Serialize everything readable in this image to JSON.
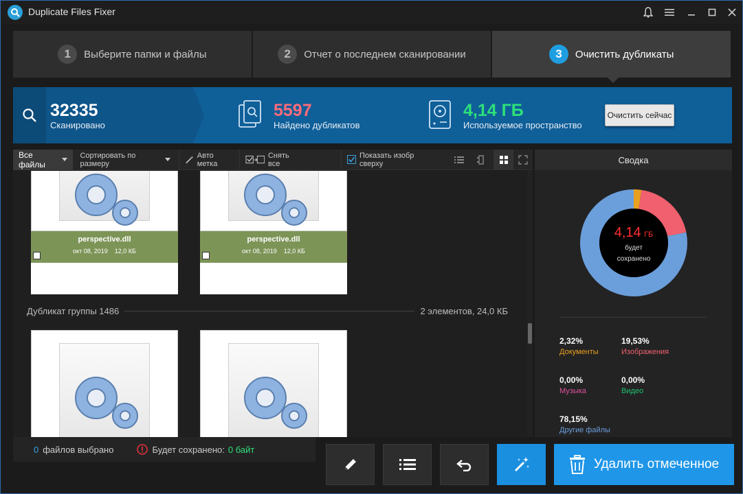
{
  "app": {
    "title": "Duplicate Files Fixer"
  },
  "steps": [
    {
      "num": "1",
      "label": "Выберите папки и файлы"
    },
    {
      "num": "2",
      "label": "Отчет о последнем сканировании"
    },
    {
      "num": "3",
      "label": "Очистить дубликаты"
    }
  ],
  "stats": {
    "scanned_value": "32335",
    "scanned_label": "Сканировано",
    "dupes_value": "5597",
    "dupes_label": "Найдено дубликатов",
    "space_value": "4,14 ГБ",
    "space_label": "Используемое пространство",
    "clean_now": "Очистить сейчас",
    "colors": {
      "dupes": "#ff6b7a",
      "space": "#2ee07a"
    }
  },
  "toolbar": {
    "all_files": "Все файлы",
    "sort": "Сортировать по размеру",
    "auto_mark": "Авто метка",
    "unselect_all": "Снять все",
    "show_preview": "Показать изобр сверху"
  },
  "files": [
    {
      "name": "perspective.dll",
      "date": "окт 08, 2019",
      "size": "12,0 КБ"
    },
    {
      "name": "perspective.dll",
      "date": "окт 08, 2019",
      "size": "12,0 КБ"
    }
  ],
  "group": {
    "title": "Дубликат группы 1486",
    "info": "2 элементов, 24,0 КБ"
  },
  "summary": {
    "title": "Сводка",
    "center_value": "4,14",
    "center_unit": "ГБ",
    "center_line1": "будет",
    "center_line2": "сохранено",
    "legend": [
      {
        "pct": "2,32%",
        "label": "Документы",
        "color": "#e8a020"
      },
      {
        "pct": "19,53%",
        "label": "Изображения",
        "color": "#f0606e"
      },
      {
        "pct": "0,00%",
        "label": "Музыка",
        "color": "#e0509a"
      },
      {
        "pct": "0,00%",
        "label": "Видео",
        "color": "#20c070"
      },
      {
        "pct": "78,15%",
        "label": "Другие файлы",
        "color": "#6b9fdc"
      }
    ]
  },
  "chart_data": {
    "type": "pie",
    "categories": [
      "Документы",
      "Изображения",
      "Музыка",
      "Видео",
      "Другие файлы"
    ],
    "values": [
      2.32,
      19.53,
      0.0,
      0.0,
      78.15
    ]
  },
  "bottom": {
    "selected_count": "0",
    "selected_label": "файлов выбрано",
    "saved_label": "Будет сохранено:",
    "saved_value": "0 байт",
    "delete_label": "Удалить отмеченное"
  }
}
